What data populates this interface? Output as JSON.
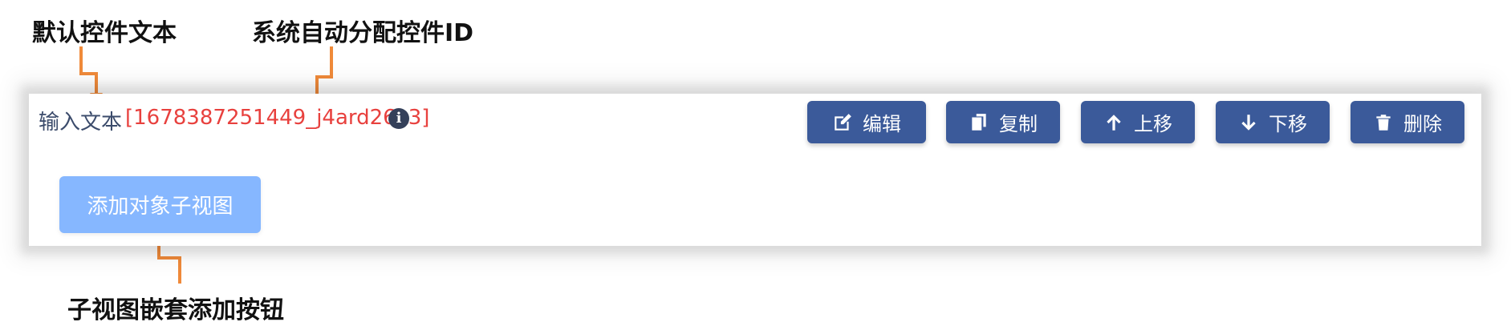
{
  "annotations": {
    "default_text": "默认控件文本",
    "system_id": "系统自动分配控件ID",
    "nested_add": "子视图嵌套添加按钮"
  },
  "control": {
    "label": "输入文本",
    "id_text": "[1678387251449_j4ard26k3]",
    "info_glyph": "i"
  },
  "buttons": {
    "edit": "编辑",
    "copy": "复制",
    "move_up": "上移",
    "move_down": "下移",
    "delete": "删除"
  },
  "add_child_button": "添加对象子视图",
  "colors": {
    "button_bg": "#3b5a9a",
    "add_button_bg": "#86b7ff",
    "id_text": "#e8413e",
    "label_text": "#3b4b6b",
    "arrow": "#f08a3a"
  }
}
